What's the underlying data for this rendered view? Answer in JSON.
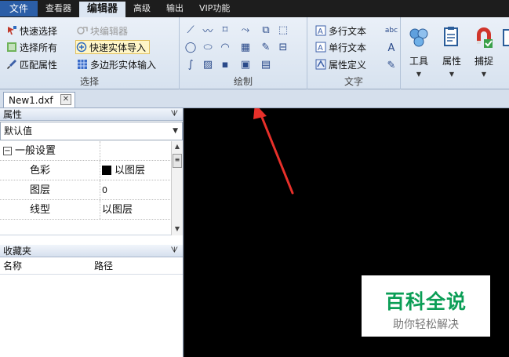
{
  "menu": {
    "items": [
      "文件",
      "查看器",
      "编辑器",
      "高级",
      "输出",
      "VIP功能"
    ],
    "active": "编辑器"
  },
  "ribbon": {
    "select_group": {
      "label": "选择",
      "items": [
        "快速选择",
        "选择所有",
        "匹配属性",
        "块编辑器",
        "快速实体导入",
        "多边形实体输入"
      ]
    },
    "draw_group": {
      "label": "绘制"
    },
    "text_group": {
      "label": "文字",
      "items": [
        "多行文本",
        "单行文本",
        "属性定义"
      ]
    },
    "big_buttons": [
      "工具",
      "属性",
      "捕捉"
    ]
  },
  "tabs": {
    "document": "New1.dxf"
  },
  "properties": {
    "title": "属性",
    "combo": "默认值",
    "section": "一般设置",
    "rows": [
      {
        "name": "色彩",
        "value": "以图层"
      },
      {
        "name": "图层",
        "value": "0"
      },
      {
        "name": "线型",
        "value": "以图层"
      }
    ]
  },
  "favorites": {
    "title": "收藏夹",
    "columns": [
      "名称",
      "路径"
    ]
  },
  "watermark": {
    "logo": "百科全说",
    "sub": "助你轻松解决"
  },
  "colors": {
    "file_menu": "#2b5ea7",
    "canvas": "#000000",
    "arrow": "#e8302a",
    "logo_green": "#0b9e56"
  }
}
